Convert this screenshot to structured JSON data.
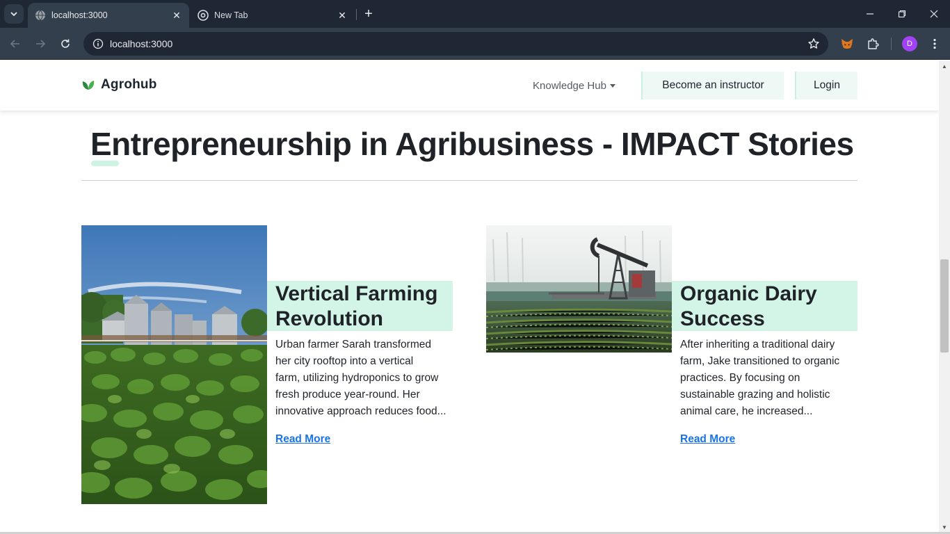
{
  "browser": {
    "tabs": [
      {
        "title": "localhost:3000",
        "active": true
      },
      {
        "title": "New Tab",
        "active": false
      }
    ],
    "url": "localhost:3000",
    "profile_initial": "D"
  },
  "site": {
    "brand": "Agrohub",
    "nav": {
      "knowledge_hub": "Knowledge Hub",
      "instructor": "Become an instructor",
      "login": "Login"
    },
    "section_title": "Entrepreneurship in Agribusiness - IMPACT Stories",
    "stories": [
      {
        "title_line1": "Vertical Farming",
        "title_line2": "Revolution",
        "lines": [
          "Urban farmer Sarah transformed",
          "her city rooftop into a vertical",
          "farm, utilizing hydroponics to grow",
          "fresh produce year-round. Her",
          "innovative approach reduces food..."
        ],
        "read_more": "Read More"
      },
      {
        "title_line1": "Organic Dairy",
        "title_line2": "Success",
        "lines": [
          "After inheriting a traditional dairy",
          "farm, Jake transitioned to organic",
          "practices. By focusing on",
          "sustainable grazing and holistic",
          "animal care, he increased..."
        ],
        "read_more": "Read More"
      }
    ]
  },
  "colors": {
    "accent_mint": "#d3f5e8",
    "link_blue": "#1a73e8",
    "text_dark": "#1f2328",
    "chrome_dark": "#1e2733"
  }
}
